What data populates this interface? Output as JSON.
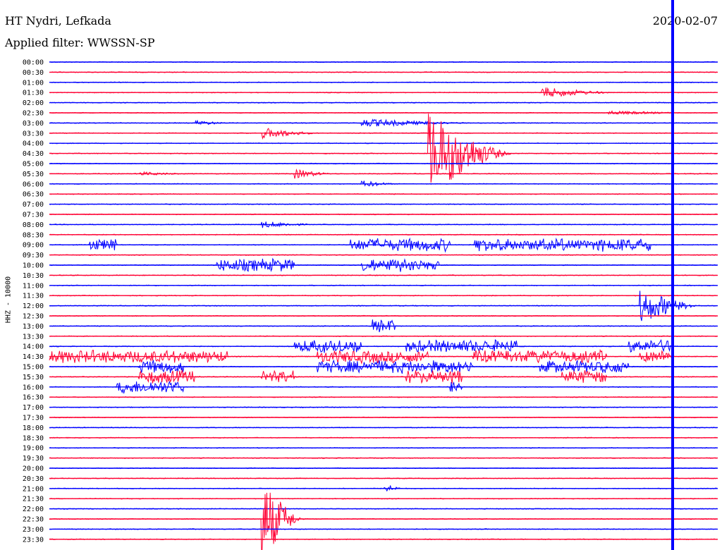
{
  "header": {
    "station": "HT Nydri, Lefkada",
    "filter": "Applied filter: WWSSN-SP",
    "date": "2020-02-07"
  },
  "channel_label": "HHZ - 10000",
  "colors": {
    "even_trace": "#0000ff",
    "odd_trace": "#ff0033",
    "background": "#ffffff"
  },
  "chart_data": {
    "type": "seismogram-helicorder",
    "row_minutes": 30,
    "row_labels": [
      "00:00",
      "00:30",
      "01:00",
      "01:30",
      "02:00",
      "02:30",
      "03:00",
      "03:30",
      "04:00",
      "04:30",
      "05:00",
      "05:30",
      "06:00",
      "06:30",
      "07:00",
      "07:30",
      "08:00",
      "08:30",
      "09:00",
      "09:30",
      "10:00",
      "10:30",
      "11:00",
      "11:30",
      "12:00",
      "12:30",
      "13:00",
      "13:30",
      "14:00",
      "14:30",
      "15:00",
      "15:30",
      "16:00",
      "16:30",
      "17:00",
      "17:30",
      "18:00",
      "18:30",
      "19:00",
      "19:30",
      "20:00",
      "20:30",
      "21:00",
      "21:30",
      "22:00",
      "22:30",
      "23:00",
      "23:30"
    ],
    "events": [
      {
        "row": 3,
        "minute": 22,
        "amplitude": 8,
        "duration": 4
      },
      {
        "row": 5,
        "minute": 25,
        "amplitude": 3,
        "duration": 5
      },
      {
        "row": 6,
        "minute": 6.5,
        "amplitude": 4,
        "duration": 2
      },
      {
        "row": 6,
        "minute": 14,
        "amplitude": 6,
        "duration": 6
      },
      {
        "row": 7,
        "minute": 9.5,
        "amplitude": 8,
        "duration": 3
      },
      {
        "row": 9,
        "minute": 17,
        "amplitude": 60,
        "duration": 4
      },
      {
        "row": 11,
        "minute": 11,
        "amplitude": 7,
        "duration": 2
      },
      {
        "row": 11,
        "minute": 4,
        "amplitude": 3,
        "duration": 3
      },
      {
        "row": 12,
        "minute": 14,
        "amplitude": 5,
        "duration": 2
      },
      {
        "row": 16,
        "minute": 9.5,
        "amplitude": 5,
        "duration": 3
      },
      {
        "row": 42,
        "minute": 15,
        "amplitude": 8,
        "duration": 1
      },
      {
        "row": 45,
        "minute": 9.5,
        "amplitude": 60,
        "duration": 2
      },
      {
        "row": 24,
        "minute": 26.5,
        "amplitude": 25,
        "duration": 3
      }
    ],
    "noisy_rows": [
      {
        "row": 18,
        "ranges": [
          [
            1.8,
            3.0
          ],
          [
            13.5,
            18
          ],
          [
            19,
            27
          ]
        ]
      },
      {
        "row": 20,
        "ranges": [
          [
            7.5,
            11
          ],
          [
            14,
            17.5
          ]
        ]
      },
      {
        "row": 26,
        "ranges": [
          [
            14.5,
            15.5
          ]
        ]
      },
      {
        "row": 28,
        "ranges": [
          [
            11,
            14
          ],
          [
            16,
            21
          ],
          [
            26,
            28
          ]
        ]
      },
      {
        "row": 29,
        "ranges": [
          [
            0,
            8
          ],
          [
            12,
            17
          ],
          [
            19,
            25
          ],
          [
            26.5,
            28
          ]
        ]
      },
      {
        "row": 30,
        "ranges": [
          [
            4,
            6
          ],
          [
            12,
            19
          ],
          [
            22,
            26
          ]
        ]
      },
      {
        "row": 31,
        "ranges": [
          [
            4,
            6.5
          ],
          [
            9.5,
            11
          ],
          [
            16,
            18.5
          ],
          [
            23,
            25
          ]
        ]
      },
      {
        "row": 32,
        "ranges": [
          [
            3,
            6
          ],
          [
            18,
            18.5
          ]
        ]
      }
    ]
  }
}
